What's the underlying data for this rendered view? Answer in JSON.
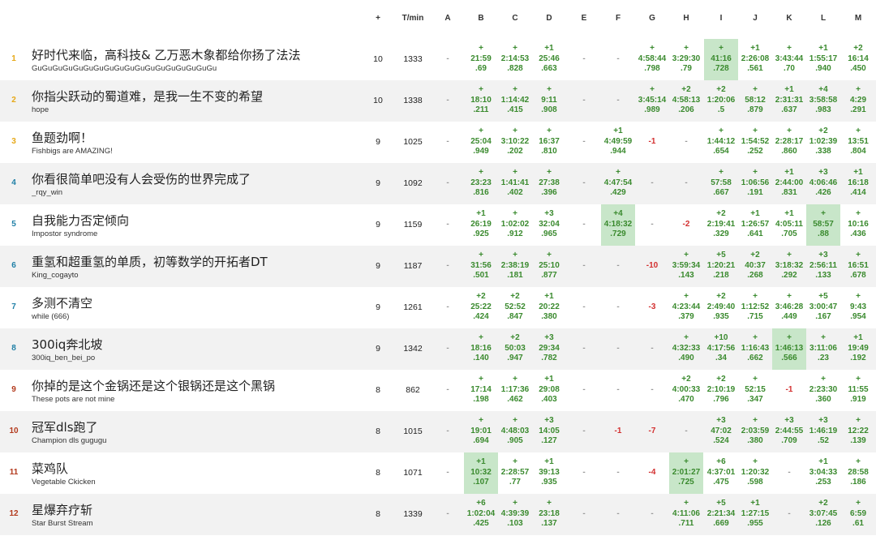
{
  "columns": {
    "solved": "+",
    "penalty": "T/min",
    "problems": [
      "A",
      "B",
      "C",
      "D",
      "E",
      "F",
      "G",
      "H",
      "I",
      "J",
      "K",
      "L",
      "M"
    ]
  },
  "colors": {
    "accepted": "#3a8a2e",
    "rejected": "#d32f2f",
    "first_blood": "#c8e6c9",
    "rank_gold": "#e6a817",
    "rank_silver": "#1f7fa6",
    "rank_bronze": "#b33a1d"
  },
  "rows": [
    {
      "rank": "1",
      "name": "好时代来临，高科技& 乙万恶木象都给你扬了法法",
      "sub": "GuGuGuGuGuGuGuGuGuGuGuGuGuGuGuGuGuGu",
      "solved": "10",
      "penalty": "1333",
      "cells": [
        {
          "status": "none",
          "t": "-"
        },
        {
          "status": "ok",
          "a": "+",
          "t": "21:59",
          "p": ".69"
        },
        {
          "status": "ok",
          "a": "+",
          "t": "2:14:53",
          "p": ".828"
        },
        {
          "status": "ok",
          "a": "+1",
          "t": "25:46",
          "p": ".663"
        },
        {
          "status": "none",
          "t": "-"
        },
        {
          "status": "none",
          "t": "-"
        },
        {
          "status": "ok",
          "a": "+",
          "t": "4:58:44",
          "p": ".798"
        },
        {
          "status": "ok",
          "a": "+",
          "t": "3:29:30",
          "p": ".79"
        },
        {
          "status": "fb",
          "a": "+",
          "t": "41:16",
          "p": ".728"
        },
        {
          "status": "ok",
          "a": "+1",
          "t": "2:26:08",
          "p": ".561"
        },
        {
          "status": "ok",
          "a": "+",
          "t": "3:43:44",
          "p": ".70"
        },
        {
          "status": "ok",
          "a": "+1",
          "t": "1:55:17",
          "p": ".940"
        },
        {
          "status": "ok",
          "a": "+2",
          "t": "16:14",
          "p": ".450"
        }
      ]
    },
    {
      "rank": "2",
      "name": "你指尖跃动的蜀道难，是我一生不变的希望",
      "sub": "hope",
      "solved": "10",
      "penalty": "1338",
      "cells": [
        {
          "status": "none",
          "t": "-"
        },
        {
          "status": "ok",
          "a": "+",
          "t": "18:10",
          "p": ".211"
        },
        {
          "status": "ok",
          "a": "+",
          "t": "1:14:42",
          "p": ".415"
        },
        {
          "status": "ok",
          "a": "+",
          "t": "9:11",
          "p": ".908"
        },
        {
          "status": "none",
          "t": "-"
        },
        {
          "status": "none",
          "t": "-"
        },
        {
          "status": "ok",
          "a": "+",
          "t": "3:45:14",
          "p": ".989"
        },
        {
          "status": "ok",
          "a": "+2",
          "t": "4:58:13",
          "p": ".206"
        },
        {
          "status": "ok",
          "a": "+2",
          "t": "1:20:06",
          "p": ".5"
        },
        {
          "status": "ok",
          "a": "+",
          "t": "58:12",
          "p": ".879"
        },
        {
          "status": "ok",
          "a": "+1",
          "t": "2:31:31",
          "p": ".637"
        },
        {
          "status": "ok",
          "a": "+4",
          "t": "3:58:58",
          "p": ".983"
        },
        {
          "status": "ok",
          "a": "+",
          "t": "4:29",
          "p": ".291"
        }
      ]
    },
    {
      "rank": "3",
      "name": "鱼题劲啊！",
      "sub": "Fishbigs are AMAZING!",
      "solved": "9",
      "penalty": "1025",
      "cells": [
        {
          "status": "none",
          "t": "-"
        },
        {
          "status": "ok",
          "a": "+",
          "t": "25:04",
          "p": ".949"
        },
        {
          "status": "ok",
          "a": "+",
          "t": "3:10:22",
          "p": ".202"
        },
        {
          "status": "ok",
          "a": "+",
          "t": "16:37",
          "p": ".810"
        },
        {
          "status": "none",
          "t": "-"
        },
        {
          "status": "ok",
          "a": "+1",
          "t": "4:49:59",
          "p": ".944"
        },
        {
          "status": "bad",
          "t": "-1"
        },
        {
          "status": "none",
          "t": "-"
        },
        {
          "status": "ok",
          "a": "+",
          "t": "1:44:12",
          "p": ".654"
        },
        {
          "status": "ok",
          "a": "+",
          "t": "1:54:52",
          "p": ".252"
        },
        {
          "status": "ok",
          "a": "+",
          "t": "2:28:17",
          "p": ".860"
        },
        {
          "status": "ok",
          "a": "+2",
          "t": "1:02:39",
          "p": ".338"
        },
        {
          "status": "ok",
          "a": "+",
          "t": "13:51",
          "p": ".804"
        }
      ]
    },
    {
      "rank": "4",
      "name": "你看很简单吧没有人会受伤的世界完成了",
      "sub": "_rqy_win",
      "solved": "9",
      "penalty": "1092",
      "cells": [
        {
          "status": "none",
          "t": "-"
        },
        {
          "status": "ok",
          "a": "+",
          "t": "23:23",
          "p": ".816"
        },
        {
          "status": "ok",
          "a": "+",
          "t": "1:41:41",
          "p": ".402"
        },
        {
          "status": "ok",
          "a": "+",
          "t": "27:38",
          "p": ".396"
        },
        {
          "status": "none",
          "t": "-"
        },
        {
          "status": "ok",
          "a": "+",
          "t": "4:47:54",
          "p": ".429"
        },
        {
          "status": "none",
          "t": "-"
        },
        {
          "status": "none",
          "t": "-"
        },
        {
          "status": "ok",
          "a": "+",
          "t": "57:58",
          "p": ".667"
        },
        {
          "status": "ok",
          "a": "+",
          "t": "1:06:56",
          "p": ".191"
        },
        {
          "status": "ok",
          "a": "+1",
          "t": "2:44:00",
          "p": ".831"
        },
        {
          "status": "ok",
          "a": "+3",
          "t": "4:06:46",
          "p": ".426"
        },
        {
          "status": "ok",
          "a": "+1",
          "t": "16:18",
          "p": ".414"
        }
      ]
    },
    {
      "rank": "5",
      "name": "自我能力否定倾向",
      "sub": "Impostor syndrome",
      "solved": "9",
      "penalty": "1159",
      "cells": [
        {
          "status": "none",
          "t": "-"
        },
        {
          "status": "ok",
          "a": "+1",
          "t": "26:19",
          "p": ".925"
        },
        {
          "status": "ok",
          "a": "+",
          "t": "1:02:02",
          "p": ".912"
        },
        {
          "status": "ok",
          "a": "+3",
          "t": "32:04",
          "p": ".965"
        },
        {
          "status": "none",
          "t": "-"
        },
        {
          "status": "fb",
          "a": "+4",
          "t": "4:18:32",
          "p": ".729"
        },
        {
          "status": "none",
          "t": "-"
        },
        {
          "status": "bad",
          "t": "-2"
        },
        {
          "status": "ok",
          "a": "+2",
          "t": "2:19:41",
          "p": ".329"
        },
        {
          "status": "ok",
          "a": "+1",
          "t": "1:26:57",
          "p": ".641"
        },
        {
          "status": "ok",
          "a": "+1",
          "t": "4:05:11",
          "p": ".705"
        },
        {
          "status": "fb",
          "a": "+",
          "t": "58:57",
          "p": ".88"
        },
        {
          "status": "ok",
          "a": "+",
          "t": "10:16",
          "p": ".436"
        }
      ]
    },
    {
      "rank": "6",
      "name": "重氢和超重氢的单质，初等数学的开拓者DT",
      "sub": "King_cogayto",
      "solved": "9",
      "penalty": "1187",
      "cells": [
        {
          "status": "none",
          "t": "-"
        },
        {
          "status": "ok",
          "a": "+",
          "t": "31:56",
          "p": ".501"
        },
        {
          "status": "ok",
          "a": "+",
          "t": "2:38:19",
          "p": ".181"
        },
        {
          "status": "ok",
          "a": "+",
          "t": "25:10",
          "p": ".877"
        },
        {
          "status": "none",
          "t": "-"
        },
        {
          "status": "none",
          "t": "-"
        },
        {
          "status": "bad",
          "t": "-10"
        },
        {
          "status": "ok",
          "a": "+",
          "t": "3:59:34",
          "p": ".143"
        },
        {
          "status": "ok",
          "a": "+5",
          "t": "1:20:21",
          "p": ".218"
        },
        {
          "status": "ok",
          "a": "+2",
          "t": "40:37",
          "p": ".268"
        },
        {
          "status": "ok",
          "a": "+",
          "t": "3:18:32",
          "p": ".292"
        },
        {
          "status": "ok",
          "a": "+3",
          "t": "2:56:11",
          "p": ".133"
        },
        {
          "status": "ok",
          "a": "+",
          "t": "16:51",
          "p": ".678"
        }
      ]
    },
    {
      "rank": "7",
      "name": "多测不清空",
      "sub": "while (666)",
      "solved": "9",
      "penalty": "1261",
      "cells": [
        {
          "status": "none",
          "t": "-"
        },
        {
          "status": "ok",
          "a": "+2",
          "t": "25:22",
          "p": ".424"
        },
        {
          "status": "ok",
          "a": "+2",
          "t": "52:52",
          "p": ".847"
        },
        {
          "status": "ok",
          "a": "+1",
          "t": "20:22",
          "p": ".380"
        },
        {
          "status": "none",
          "t": "-"
        },
        {
          "status": "none",
          "t": "-"
        },
        {
          "status": "bad",
          "t": "-3"
        },
        {
          "status": "ok",
          "a": "+",
          "t": "4:23:44",
          "p": ".379"
        },
        {
          "status": "ok",
          "a": "+2",
          "t": "2:49:40",
          "p": ".935"
        },
        {
          "status": "ok",
          "a": "+",
          "t": "1:12:52",
          "p": ".715"
        },
        {
          "status": "ok",
          "a": "+",
          "t": "3:46:28",
          "p": ".449"
        },
        {
          "status": "ok",
          "a": "+5",
          "t": "3:00:47",
          "p": ".167"
        },
        {
          "status": "ok",
          "a": "+",
          "t": "9:43",
          "p": ".954"
        }
      ]
    },
    {
      "rank": "8",
      "name": "300iq奔北坡",
      "sub": "300iq_ben_bei_po",
      "solved": "9",
      "penalty": "1342",
      "cells": [
        {
          "status": "none",
          "t": "-"
        },
        {
          "status": "ok",
          "a": "+",
          "t": "18:16",
          "p": ".140"
        },
        {
          "status": "ok",
          "a": "+2",
          "t": "50:03",
          "p": ".947"
        },
        {
          "status": "ok",
          "a": "+3",
          "t": "29:34",
          "p": ".782"
        },
        {
          "status": "none",
          "t": "-"
        },
        {
          "status": "none",
          "t": "-"
        },
        {
          "status": "none",
          "t": "-"
        },
        {
          "status": "ok",
          "a": "+",
          "t": "4:32:33",
          "p": ".490"
        },
        {
          "status": "ok",
          "a": "+10",
          "t": "4:17:56",
          "p": ".34"
        },
        {
          "status": "ok",
          "a": "+",
          "t": "1:16:43",
          "p": ".662"
        },
        {
          "status": "fb",
          "a": "+",
          "t": "1:46:13",
          "p": ".566"
        },
        {
          "status": "ok",
          "a": "+",
          "t": "3:11:06",
          "p": ".23"
        },
        {
          "status": "ok",
          "a": "+1",
          "t": "19:49",
          "p": ".192"
        }
      ]
    },
    {
      "rank": "9",
      "name": "你掉的是这个金锅还是这个银锅还是这个黑锅",
      "sub": "These pots are not mine",
      "solved": "8",
      "penalty": "862",
      "cells": [
        {
          "status": "none",
          "t": "-"
        },
        {
          "status": "ok",
          "a": "+",
          "t": "17:14",
          "p": ".198"
        },
        {
          "status": "ok",
          "a": "+",
          "t": "1:17:36",
          "p": ".462"
        },
        {
          "status": "ok",
          "a": "+1",
          "t": "29:08",
          "p": ".403"
        },
        {
          "status": "none",
          "t": "-"
        },
        {
          "status": "none",
          "t": "-"
        },
        {
          "status": "none",
          "t": "-"
        },
        {
          "status": "ok",
          "a": "+2",
          "t": "4:00:33",
          "p": ".470"
        },
        {
          "status": "ok",
          "a": "+2",
          "t": "2:10:19",
          "p": ".796"
        },
        {
          "status": "ok",
          "a": "+",
          "t": "52:15",
          "p": ".347"
        },
        {
          "status": "bad",
          "t": "-1"
        },
        {
          "status": "ok",
          "a": "+",
          "t": "2:23:30",
          "p": ".360"
        },
        {
          "status": "ok",
          "a": "+",
          "t": "11:55",
          "p": ".919"
        }
      ]
    },
    {
      "rank": "10",
      "name": "冠军dls跑了",
      "sub": "Champion dls gugugu",
      "solved": "8",
      "penalty": "1015",
      "cells": [
        {
          "status": "none",
          "t": "-"
        },
        {
          "status": "ok",
          "a": "+",
          "t": "19:01",
          "p": ".694"
        },
        {
          "status": "ok",
          "a": "+",
          "t": "4:48:03",
          "p": ".905"
        },
        {
          "status": "ok",
          "a": "+3",
          "t": "14:05",
          "p": ".127"
        },
        {
          "status": "none",
          "t": "-"
        },
        {
          "status": "bad",
          "t": "-1"
        },
        {
          "status": "bad",
          "t": "-7"
        },
        {
          "status": "none",
          "t": "-"
        },
        {
          "status": "ok",
          "a": "+3",
          "t": "47:02",
          "p": ".524"
        },
        {
          "status": "ok",
          "a": "+",
          "t": "2:03:59",
          "p": ".380"
        },
        {
          "status": "ok",
          "a": "+3",
          "t": "2:44:55",
          "p": ".709"
        },
        {
          "status": "ok",
          "a": "+3",
          "t": "1:46:19",
          "p": ".52"
        },
        {
          "status": "ok",
          "a": "+",
          "t": "12:22",
          "p": ".139"
        }
      ]
    },
    {
      "rank": "11",
      "name": "菜鸡队",
      "sub": "Vegetable Ckicken",
      "solved": "8",
      "penalty": "1071",
      "cells": [
        {
          "status": "none",
          "t": "-"
        },
        {
          "status": "fb",
          "a": "+1",
          "t": "10:32",
          "p": ".107"
        },
        {
          "status": "ok",
          "a": "+",
          "t": "2:28:57",
          "p": ".77"
        },
        {
          "status": "ok",
          "a": "+1",
          "t": "39:13",
          "p": ".935"
        },
        {
          "status": "none",
          "t": "-"
        },
        {
          "status": "none",
          "t": "-"
        },
        {
          "status": "bad",
          "t": "-4"
        },
        {
          "status": "fb",
          "a": "+",
          "t": "2:01:27",
          "p": ".725"
        },
        {
          "status": "ok",
          "a": "+6",
          "t": "4:37:01",
          "p": ".475"
        },
        {
          "status": "ok",
          "a": "+",
          "t": "1:20:32",
          "p": ".598"
        },
        {
          "status": "none",
          "t": "-"
        },
        {
          "status": "ok",
          "a": "+1",
          "t": "3:04:33",
          "p": ".253"
        },
        {
          "status": "ok",
          "a": "+",
          "t": "28:58",
          "p": ".186"
        }
      ]
    },
    {
      "rank": "12",
      "name": "星爆弃疗斩",
      "sub": "Star Burst Stream",
      "solved": "8",
      "penalty": "1339",
      "cells": [
        {
          "status": "none",
          "t": "-"
        },
        {
          "status": "ok",
          "a": "+6",
          "t": "1:02:04",
          "p": ".425"
        },
        {
          "status": "ok",
          "a": "+",
          "t": "4:39:39",
          "p": ".103"
        },
        {
          "status": "ok",
          "a": "+",
          "t": "23:18",
          "p": ".137"
        },
        {
          "status": "none",
          "t": "-"
        },
        {
          "status": "none",
          "t": "-"
        },
        {
          "status": "none",
          "t": "-"
        },
        {
          "status": "ok",
          "a": "+",
          "t": "4:11:06",
          "p": ".711"
        },
        {
          "status": "ok",
          "a": "+5",
          "t": "2:21:34",
          "p": ".669"
        },
        {
          "status": "ok",
          "a": "+1",
          "t": "1:27:15",
          "p": ".955"
        },
        {
          "status": "none",
          "t": "-"
        },
        {
          "status": "ok",
          "a": "+2",
          "t": "3:07:45",
          "p": ".126"
        },
        {
          "status": "ok",
          "a": "+",
          "t": "6:59",
          "p": ".61"
        }
      ]
    }
  ]
}
